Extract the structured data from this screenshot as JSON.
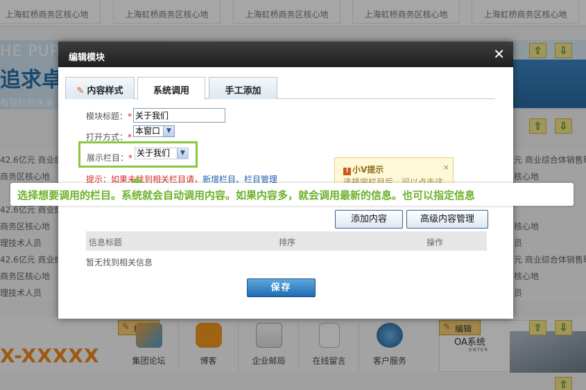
{
  "background": {
    "top_cells": [
      "上海虹桥商务区核心地",
      "上海虹桥商务区核心地",
      "上海虹桥商务区核心地",
      "上海虹桥商务区核心地",
      "上海虹桥商务区核心地"
    ],
    "banner_en": "HE PURSU",
    "banner_cn": "追求卓",
    "banner_sub": "有目标的未来",
    "left_list": [
      "42.6亿元 商业综",
      "商务区核心地",
      "42.6亿元 商业综",
      "商务区核心地",
      "理技术人员",
      "42.6亿元 商业综",
      "商务区核心地",
      "理技术人员"
    ],
    "right_list": [
      "元 商业综合体销售职",
      "核心地",
      "核心地",
      "员",
      "元 商业综合体销售职",
      "核心地",
      "员"
    ],
    "phone": "X-XXXXX",
    "edit_label": "编辑",
    "quick_links": [
      "集团论坛",
      "博客",
      "企业邮局",
      "在线留言",
      "客户服务"
    ],
    "oa_title": "OA系统",
    "oa_sub": "ENTER",
    "arrow_up": "⇧",
    "arrow_down": "⇩"
  },
  "modal": {
    "title": "编辑模块",
    "close_glyph": "✕",
    "tabs": [
      {
        "label": "内容样式",
        "icon": "pen-icon"
      },
      {
        "label": "系统调用",
        "active": true
      },
      {
        "label": "手工添加"
      }
    ],
    "form": {
      "title_label": "模块标题：",
      "title_value": "关于我们",
      "open_label": "打开方式：",
      "open_value": "本窗口",
      "column_label": "展示栏目：",
      "column_value": "关于我们",
      "required_mark": "*"
    },
    "hint": {
      "prefix": "提示：如果未找到相关栏目请，",
      "link1": "新增栏目",
      "sep": "、",
      "link2": "栏目管理"
    },
    "vtip": {
      "title": "小V提示",
      "body": "选择完栏目后，可以点击这",
      "close": "×"
    },
    "buttons": {
      "add_content": "添加内容",
      "advanced": "高级内容管理",
      "save": "保存"
    },
    "table": {
      "headers": [
        "信息标题",
        "排序",
        "操作"
      ],
      "empty": "暂无找到相关信息"
    }
  },
  "annotation": {
    "text": "选择想要调用的栏目。系统就会自动调用内容。如果内容多，就会调用最新的信息。也可以指定信息"
  },
  "colors": {
    "accent_green": "#8cc63f",
    "callout_text": "#6db12b",
    "save_blue": "#1f6bb0",
    "required_red": "#e02020"
  }
}
